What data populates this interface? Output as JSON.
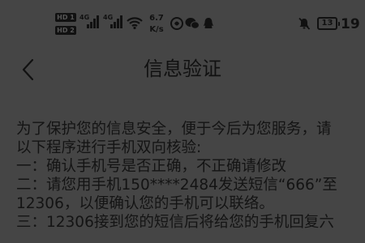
{
  "status_bar": {
    "sim1_label": "HD 1",
    "sim2_label": "HD 2",
    "sim1_network": "4G",
    "sim2_network": "4G",
    "net_speed_value": "6.7",
    "net_speed_unit": "K/s",
    "battery_level": "13",
    "clock": "19"
  },
  "header": {
    "title": "信息验证",
    "back_icon": "chevron-left-icon"
  },
  "content": {
    "lines": [
      "为了保护您的信息安全，便于今后为您服务，请",
      "以下程序进行手机双向核验:",
      "一：确认手机号是否正确，不正确请修改",
      "二：请您用手机150****2484发送短信“666”至",
      "12306，以便确认您的手机可以联络。",
      "三：12306接到您的短信后将给您的手机回复六"
    ]
  },
  "colors": {
    "background": "#454545",
    "text": "#141414"
  }
}
